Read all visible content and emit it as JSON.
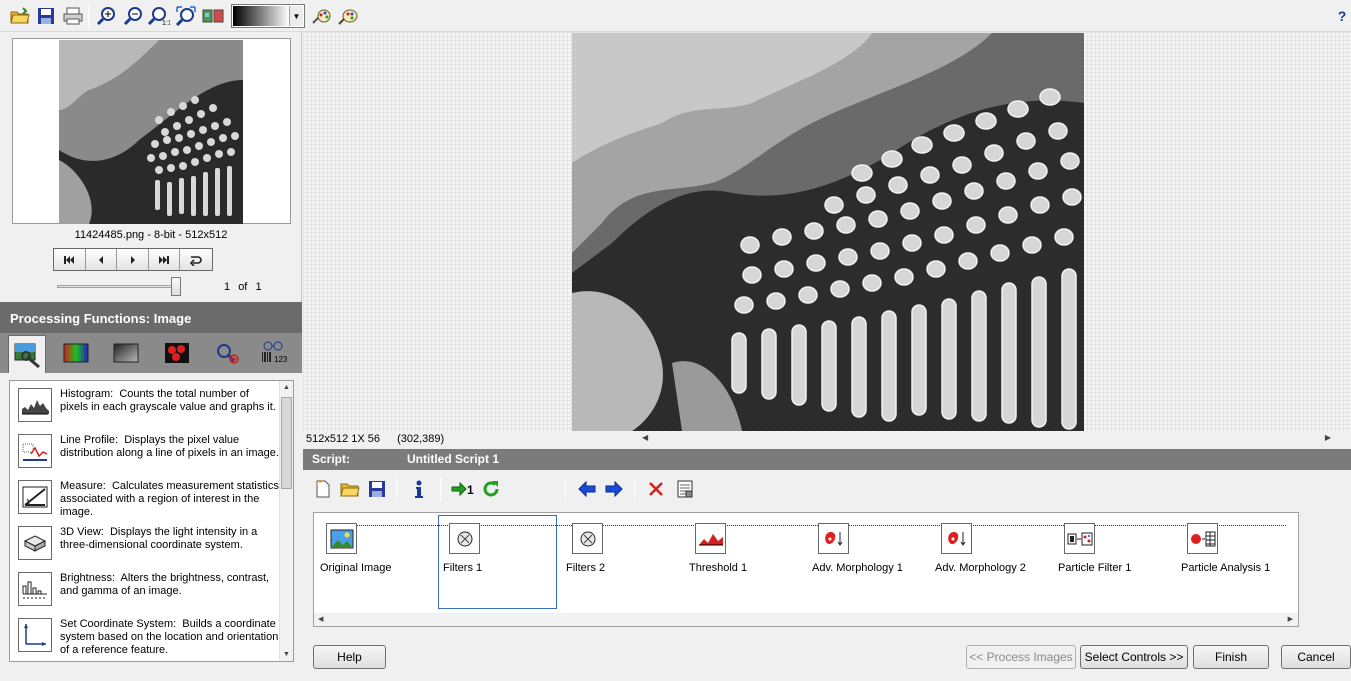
{
  "toolbar": {
    "buttons": [
      "open-image-icon",
      "save-image-icon",
      "print-icon",
      "zoom-in-icon",
      "zoom-out-icon",
      "zoom-1-1-icon",
      "zoom-fit-icon",
      "image-type-icon",
      "palette-gradient-select",
      "magic-wand-icon",
      "color-palette-icon",
      "help-icon"
    ],
    "help_label": "?"
  },
  "thumbnail": {
    "image_info": "11424485.png - 8-bit - 512x512",
    "page_current": "1",
    "page_of": "of",
    "page_total": "1"
  },
  "processing": {
    "header": "Processing Functions: Image",
    "tabs": [
      "image-tab",
      "color-tab",
      "grayscale-tab",
      "binary-tab",
      "machine-vision-tab",
      "identification-tab"
    ],
    "items": [
      {
        "title": "Histogram:",
        "text": "Counts the total number of pixels in each grayscale value and graphs it."
      },
      {
        "title": "Line Profile:",
        "text": "Displays the pixel value distribution along a line of pixels in an image."
      },
      {
        "title": "Measure:",
        "text": "Calculates measurement statistics associated with a region of interest in the image."
      },
      {
        "title": "3D View:",
        "text": "Displays the light intensity in a three-dimensional coordinate system."
      },
      {
        "title": "Brightness:",
        "text": "Alters the brightness, contrast, and gamma of an image."
      },
      {
        "title": "Set Coordinate System:",
        "text": "Builds a coordinate system based on the location and orientation of a reference feature."
      }
    ]
  },
  "view_status": {
    "size_zoom": "512x512 1X 56",
    "coords": "(302,389)"
  },
  "script": {
    "label": "Script:",
    "name": "Untitled Script 1",
    "steps": [
      "Original Image",
      "Filters 1",
      "Filters 2",
      "Threshold 1",
      "Adv. Morphology 1",
      "Adv. Morphology 2",
      "Particle Filter 1",
      "Particle Analysis 1"
    ],
    "selected_step": "Filters 1"
  },
  "buttons": {
    "help": "Help",
    "process_images": "<< Process Images",
    "select_controls": "Select Controls >>",
    "finish": "Finish",
    "cancel": "Cancel"
  },
  "colors": {
    "header_gray": "#6b6b6b",
    "tab_strip": "#8a8a8a",
    "script_header": "#7b7b7b",
    "selection_blue": "#3a6bc5",
    "flow_line": "#6a1a4a"
  }
}
